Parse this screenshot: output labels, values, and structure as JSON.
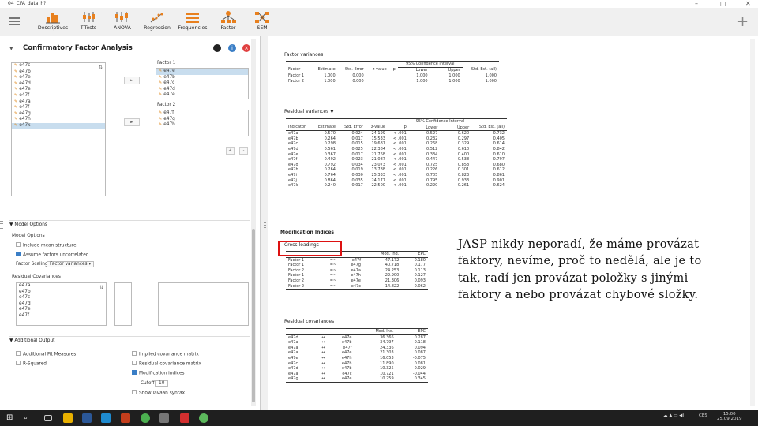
{
  "window": {
    "title": "04_CFA_data_h?",
    "controls": [
      "–",
      "□",
      "✕"
    ]
  },
  "toolbar": {
    "items": [
      {
        "label": "Descriptives"
      },
      {
        "label": "T-Tests"
      },
      {
        "label": "ANOVA"
      },
      {
        "label": "Regression"
      },
      {
        "label": "Frequencies"
      },
      {
        "label": "Factor"
      },
      {
        "label": "SEM"
      }
    ],
    "plus": "+"
  },
  "left": {
    "panel_title": "Confirmatory Factor Analysis",
    "variables": [
      "e47c",
      "e47b",
      "e47e",
      "e47d",
      "e47e",
      "e47f",
      "e47a",
      "e47f",
      "e47g",
      "e47h",
      "e47k"
    ],
    "factor1": {
      "name": "Factor 1",
      "items": [
        "e47e",
        "e47b",
        "e47c",
        "e47d",
        "e47e"
      ]
    },
    "factor2": {
      "name": "Factor 2",
      "items": [
        "e47f",
        "e47g",
        "e47h"
      ]
    },
    "add": "+",
    "remove": "-",
    "model_options": {
      "header": "Model Options",
      "sub": "Model Options",
      "include_mean": "Include mean structure",
      "assume_uncorr": "Assume factors uncorrelated",
      "scaling_label": "Factor Scaling",
      "scaling_value": "Factor variances"
    },
    "residual_cov": {
      "label": "Residual Covariances",
      "items": [
        "e47a",
        "e47b",
        "e47c",
        "e47d",
        "e47e",
        "e47f"
      ]
    },
    "additional": {
      "header": "Additional Output",
      "fit": "Additional Fit Measures",
      "rsq": "R-Squared",
      "implied": "Implied covariance matrix",
      "residual": "Residual covariance matrix",
      "mi": "Modification indices",
      "cutoff_label": "Cutoff",
      "cutoff_value": "10",
      "lavaan": "Show lavaan syntax"
    }
  },
  "out": {
    "fv_title": "Factor variances",
    "fv_ci": "95% Confidence Interval",
    "fv_cols": [
      "Factor",
      "Estimate",
      "Std. Error",
      "z-value",
      "p",
      "Lower",
      "Upper",
      "Std. Est. (all)"
    ],
    "fv_rows": [
      [
        "Factor 1",
        "1.000",
        "0.000",
        "",
        "",
        "1.000",
        "1.000",
        "1.000"
      ],
      [
        "Factor 2",
        "1.000",
        "0.000",
        "",
        "",
        "1.000",
        "1.000",
        "1.000"
      ]
    ],
    "rv_title": "Residual variances ▼",
    "rv_ci": "95% Confidence Interval",
    "rv_cols": [
      "Indicator",
      "Estimate",
      "Std. Error",
      "z-value",
      "p",
      "Lower",
      "Upper",
      "Std. Est. (all)"
    ],
    "rv_rows": [
      [
        "e47a",
        "0.570",
        "0.024",
        "24.199",
        "< .001",
        "0.527",
        "0.620",
        "0.732"
      ],
      [
        "e47b",
        "0.264",
        "0.017",
        "15.533",
        "< .001",
        "0.232",
        "0.297",
        "0.405"
      ],
      [
        "e47c",
        "0.298",
        "0.015",
        "19.681",
        "< .001",
        "0.268",
        "0.329",
        "0.614"
      ],
      [
        "e47d",
        "0.561",
        "0.025",
        "22.384",
        "< .001",
        "0.512",
        "0.610",
        "0.842"
      ],
      [
        "e47e",
        "0.367",
        "0.017",
        "21.768",
        "< .001",
        "0.334",
        "0.400",
        "0.610"
      ],
      [
        "e47f",
        "0.492",
        "0.023",
        "21.087",
        "< .001",
        "0.447",
        "0.538",
        "0.797"
      ],
      [
        "e47g",
        "0.792",
        "0.034",
        "23.073",
        "< .001",
        "0.725",
        "0.858",
        "0.680"
      ],
      [
        "e47h",
        "0.264",
        "0.019",
        "13.788",
        "< .001",
        "0.226",
        "0.301",
        "0.612"
      ],
      [
        "e47i",
        "0.764",
        "0.030",
        "25.333",
        "< .001",
        "0.705",
        "0.823",
        "0.861"
      ],
      [
        "e47j",
        "0.864",
        "0.035",
        "24.177",
        "< .001",
        "0.795",
        "0.933",
        "0.901"
      ],
      [
        "e47k",
        "0.240",
        "0.017",
        "22.500",
        "< .001",
        "0.220",
        "0.261",
        "0.624"
      ]
    ],
    "mi_title": "Modification Indices",
    "cl_title": "Cross-loadings",
    "cl_cols": [
      "",
      "",
      "",
      "Mod. Ind.",
      "EPC"
    ],
    "cl_rows": [
      [
        "Factor 1",
        "=~",
        "e47f",
        "47.172",
        "0.180"
      ],
      [
        "Factor 1",
        "=~",
        "e47g",
        "40.718",
        "0.177"
      ],
      [
        "Factor 2",
        "=~",
        "e47a",
        "24.253",
        "0.113"
      ],
      [
        "Factor 1",
        "=~",
        "e47h",
        "22.900",
        "0.127"
      ],
      [
        "Factor 2",
        "=~",
        "e47e",
        "21.306",
        "0.093"
      ],
      [
        "Factor 2",
        "=~",
        "e47c",
        "14.822",
        "0.062"
      ]
    ],
    "rc_title": "Residual covariances",
    "rc_cols": [
      "",
      "",
      "",
      "Mod. Ind.",
      "EPC"
    ],
    "rc_rows": [
      [
        "e47d",
        "↔",
        "e47e",
        "36.366",
        "0.287"
      ],
      [
        "e47a",
        "↔",
        "e47b",
        "34.797",
        "0.118"
      ],
      [
        "e47a",
        "↔",
        "e47f",
        "24.336",
        "0.094"
      ],
      [
        "e47a",
        "↔",
        "e47e",
        "21.303",
        "0.087"
      ],
      [
        "e47e",
        "↔",
        "e47h",
        "16.053",
        "-0.075"
      ],
      [
        "e47c",
        "↔",
        "e47h",
        "11.890",
        "0.081"
      ],
      [
        "e47d",
        "↔",
        "e47b",
        "10.325",
        "0.029"
      ],
      [
        "e47a",
        "↔",
        "e47c",
        "10.721",
        "-0.044"
      ],
      [
        "e47g",
        "↔",
        "e47e",
        "10.259",
        "0.345"
      ]
    ]
  },
  "annotation": "JASP nikdy neporadí, že máme provázat faktory, nevíme, proč to nedělá, ale je to tak, radí jen provázat položky s jinými faktory a nebo provázat chybové složky.",
  "taskbar": {
    "lang": "CES",
    "time": "15:00",
    "date": "25.09.2019"
  },
  "colors": {
    "accent": "#3a7ec6",
    "annotation_box": "#d11111",
    "toolbar_icon": "#e8801e"
  }
}
